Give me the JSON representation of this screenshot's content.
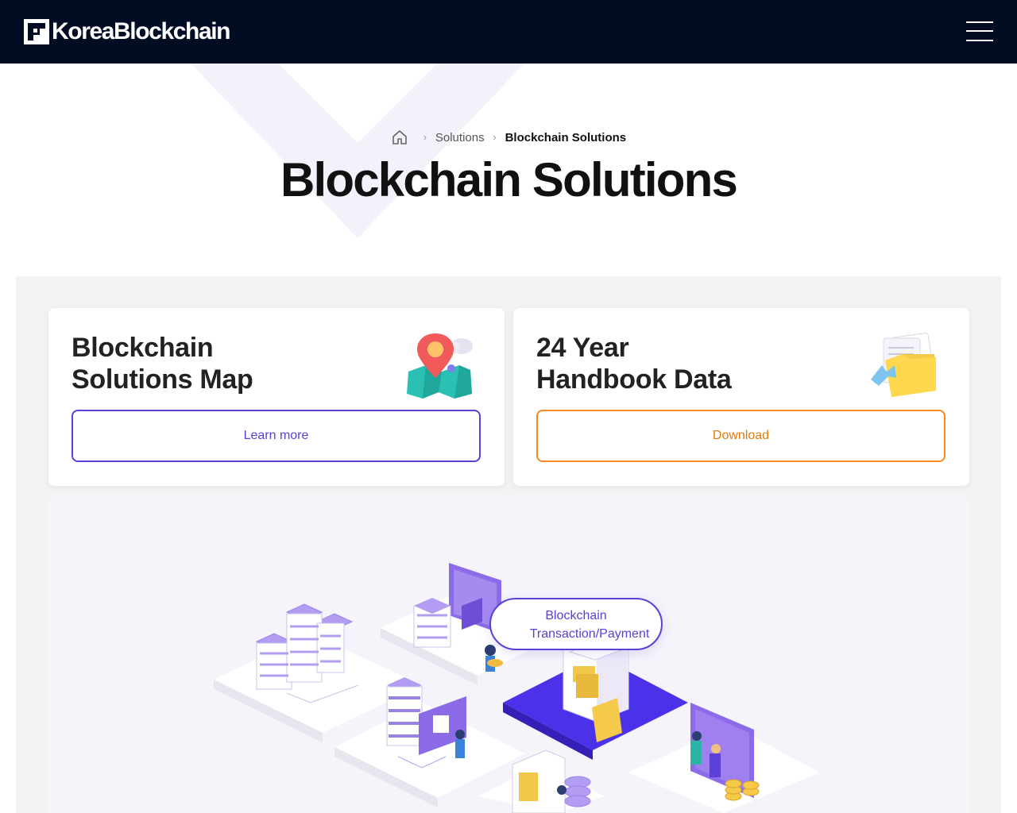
{
  "header": {
    "brand": "KoreaBlockchain",
    "menu_icon": "hamburger-menu-icon"
  },
  "breadcrumb": {
    "home_icon": "home-icon",
    "items": [
      "Solutions",
      "Blockchain Solutions"
    ]
  },
  "page": {
    "title": "Blockchain Solutions"
  },
  "cards": [
    {
      "title": "Blockchain\nSolutions Map",
      "button_label": "Learn more",
      "icon": "map-pin-icon",
      "accent": "#5b3fd6"
    },
    {
      "title": "24 Year\nHandbook Data",
      "button_label": "Download",
      "icon": "folder-icon",
      "accent": "#f5891f"
    }
  ],
  "diagram": {
    "bubble_line1": "Blockchain",
    "bubble_line2": "Transaction/Payment",
    "illustration": "isometric-blockchain-network-illustration"
  },
  "colors": {
    "header_bg": "#020d23",
    "primary": "#5b3fd6",
    "orange": "#f5891f"
  }
}
